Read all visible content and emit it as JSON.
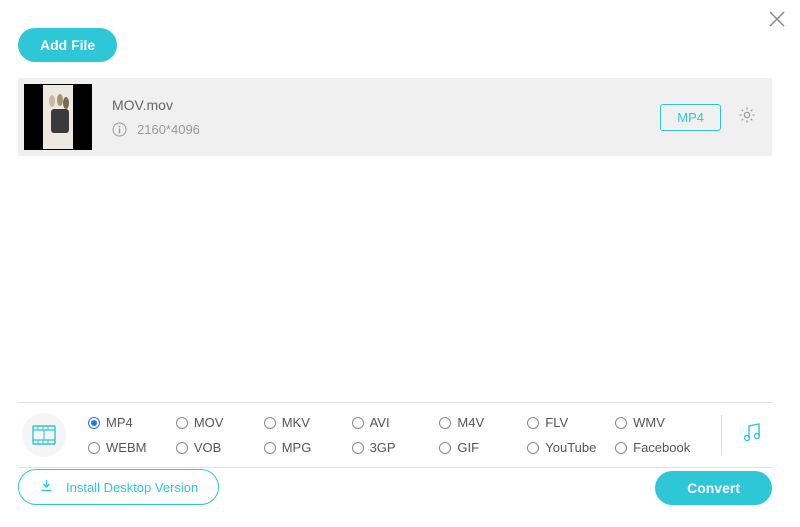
{
  "header": {
    "add_label": "Add File"
  },
  "file": {
    "name": "MOV.mov",
    "resolution": "2160*4096",
    "target_format": "MP4"
  },
  "formats": {
    "row1": [
      {
        "label": "MP4",
        "selected": true
      },
      {
        "label": "MOV",
        "selected": false
      },
      {
        "label": "MKV",
        "selected": false
      },
      {
        "label": "AVI",
        "selected": false
      },
      {
        "label": "M4V",
        "selected": false
      },
      {
        "label": "FLV",
        "selected": false
      },
      {
        "label": "WMV",
        "selected": false
      }
    ],
    "row2": [
      {
        "label": "WEBM",
        "selected": false
      },
      {
        "label": "VOB",
        "selected": false
      },
      {
        "label": "MPG",
        "selected": false
      },
      {
        "label": "3GP",
        "selected": false
      },
      {
        "label": "GIF",
        "selected": false
      },
      {
        "label": "YouTube",
        "selected": false
      },
      {
        "label": "Facebook",
        "selected": false
      }
    ]
  },
  "footer": {
    "install_label": "Install Desktop Version",
    "convert_label": "Convert"
  }
}
